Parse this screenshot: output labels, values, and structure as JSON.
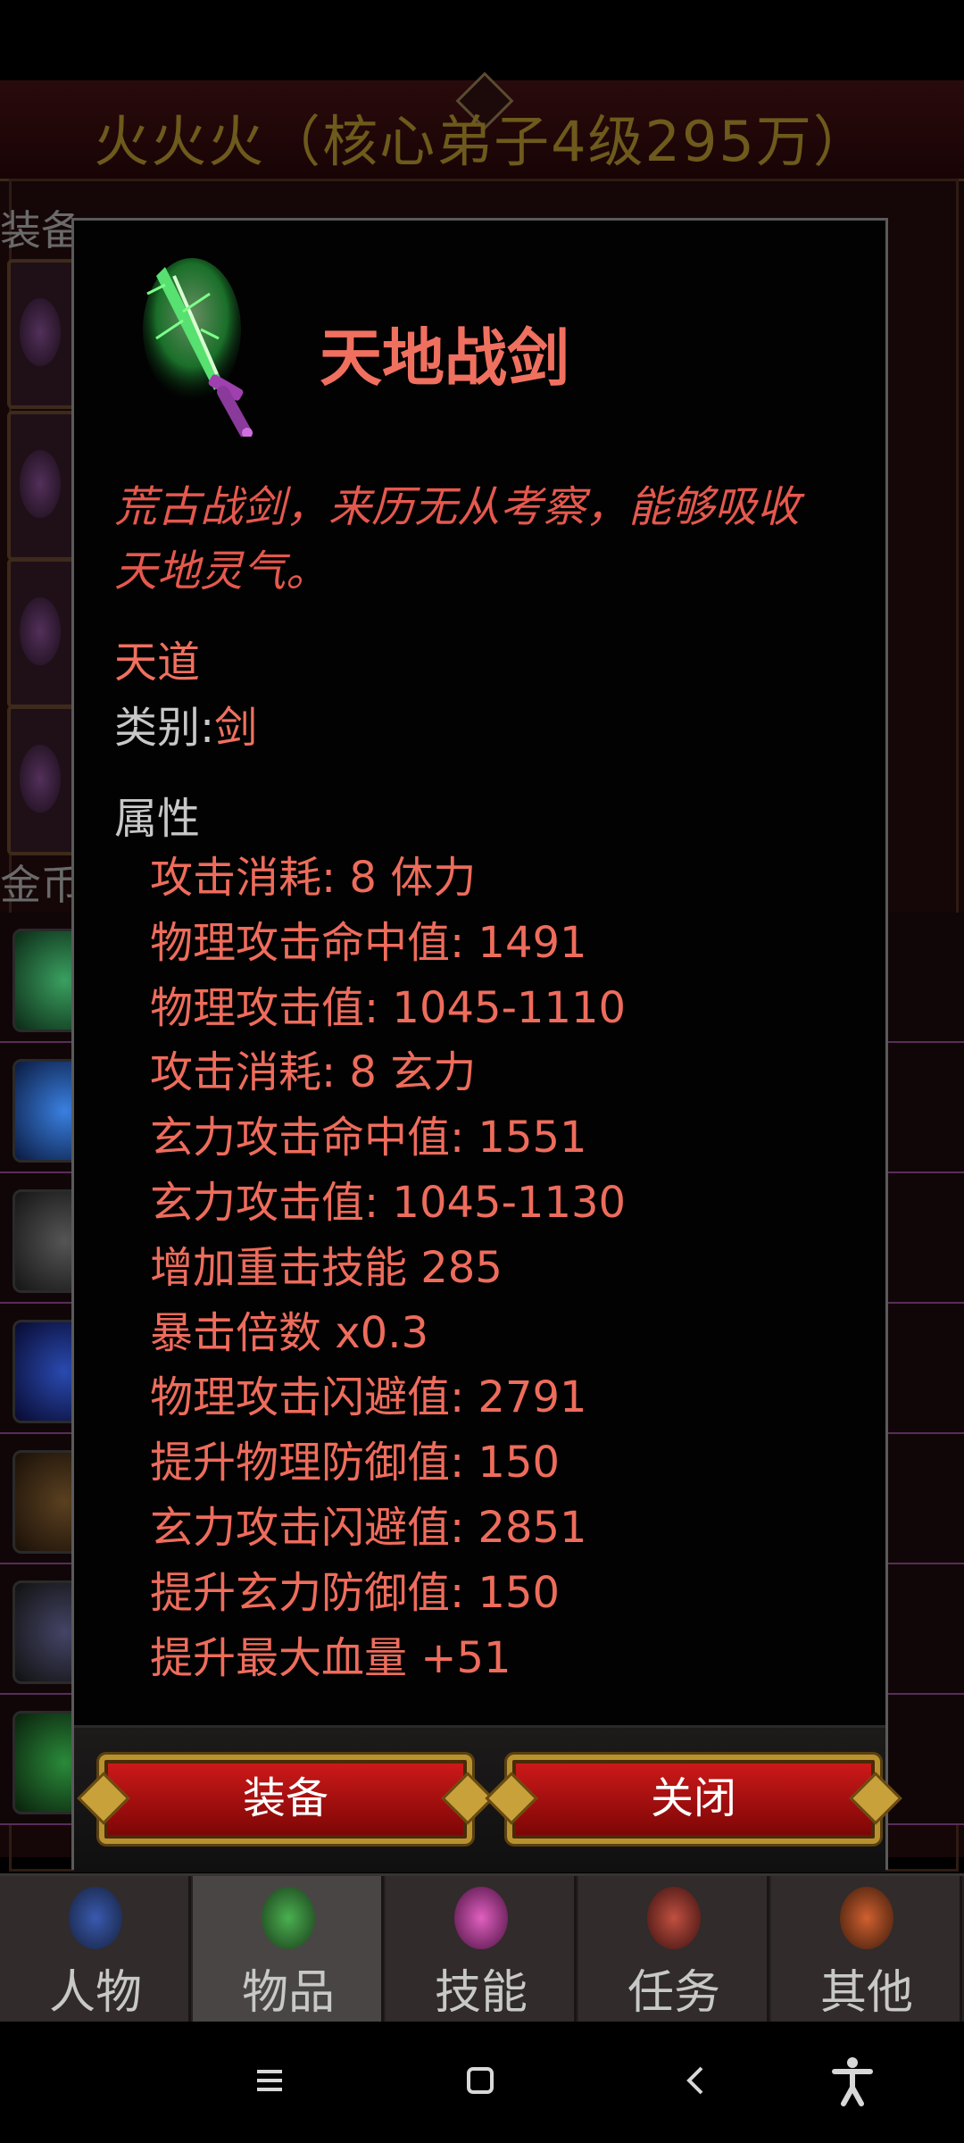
{
  "header": {
    "character_title": "火火火（核心弟子4级295万）"
  },
  "background": {
    "equipment_label": "装备",
    "gold_label": "金币:1"
  },
  "item": {
    "name": "天地战剑",
    "icon": "green-sword-icon",
    "description": "荒古战剑，来历无从考察，能够吸收天地灵气。",
    "grade": "天道",
    "category_label": "类别:",
    "category_value": "剑",
    "attributes_header": "属性",
    "attributes": [
      "攻击消耗: 8 体力",
      "物理攻击命中值: 1491",
      "物理攻击值:  1045-1110",
      "攻击消耗: 8 玄力",
      "玄力攻击命中值: 1551",
      "玄力攻击值:  1045-1130",
      "增加重击技能 285",
      "暴击倍数 x0.3",
      "物理攻击闪避值: 2791",
      "提升物理防御值: 150",
      "玄力攻击闪避值: 2851",
      "提升玄力防御值: 150",
      "提升最大血量 +51"
    ]
  },
  "buttons": {
    "equip": "装备",
    "close": "关闭"
  },
  "tabs": [
    {
      "label": "人物",
      "icon": "character-icon",
      "active": false
    },
    {
      "label": "物品",
      "icon": "potion-icon",
      "active": true
    },
    {
      "label": "技能",
      "icon": "skill-orb-icon",
      "active": false
    },
    {
      "label": "任务",
      "icon": "quest-icon",
      "active": false
    },
    {
      "label": "其他",
      "icon": "other-icon",
      "active": false
    }
  ],
  "nav": {
    "menu_icon": "menu-icon",
    "home_icon": "home-icon",
    "back_icon": "back-icon",
    "accessibility_icon": "accessibility-icon"
  },
  "colors": {
    "item_text": "#f07060",
    "title_gold": "#6d5a1c",
    "button_red": "#c81414",
    "button_gold": "#b8922e"
  }
}
